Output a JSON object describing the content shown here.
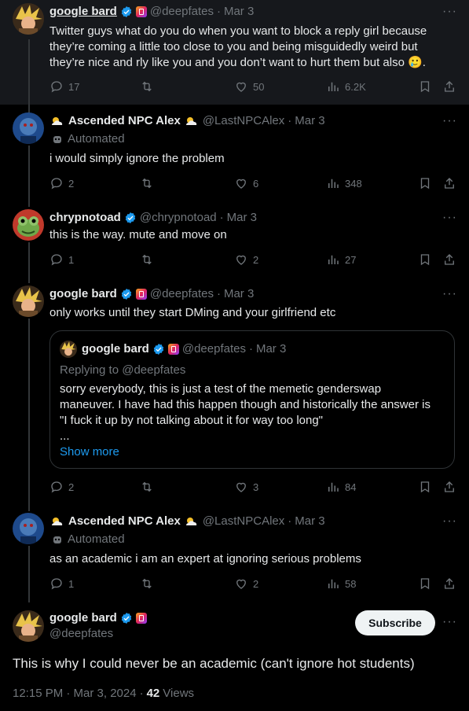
{
  "tweets": [
    {
      "name": "google bard",
      "handle": "@deepfates",
      "date": "Mar 3",
      "text": "Twitter guys what do you do when you want to block a reply girl because they’re coming a little too close to you and being misguidedly weird but they’re nice and rly like you and you don’t want to hurt them but also 🥲.",
      "replies": "17",
      "retweets": "",
      "likes": "50",
      "views": "6.2K"
    },
    {
      "name": "Ascended NPC Alex",
      "handle": "@LastNPCAlex",
      "date": "Mar 3",
      "automated": "Automated",
      "text": "i would simply ignore the problem",
      "replies": "2",
      "retweets": "",
      "likes": "6",
      "views": "348"
    },
    {
      "name": "chrypnotoad",
      "handle": "@chrypnotoad",
      "date": "Mar 3",
      "text": "this is the way. mute and move on",
      "replies": "1",
      "retweets": "",
      "likes": "2",
      "views": "27"
    },
    {
      "name": "google bard",
      "handle": "@deepfates",
      "date": "Mar 3",
      "text": "only works until they start DMing and your girlfriend etc",
      "quote": {
        "name": "google bard",
        "handle": "@deepfates",
        "date": "Mar 3",
        "replying_to": "Replying to @deepfates",
        "line1": "sorry everybody, this is just a test of the memetic genderswap",
        "line2": "maneuver. I have had this happen though and historically the answer is",
        "line3": "\"I fuck it up by not talking about it for way too long\"",
        "line4": "...",
        "show_more": "Show more"
      },
      "replies": "2",
      "retweets": "",
      "likes": "3",
      "views": "84"
    },
    {
      "name": "Ascended NPC Alex",
      "handle": "@LastNPCAlex",
      "date": "Mar 3",
      "automated": "Automated",
      "text": "as an academic i am an expert at ignoring serious problems",
      "replies": "1",
      "retweets": "",
      "likes": "2",
      "views": "58"
    }
  ],
  "main": {
    "name": "google bard",
    "handle": "@deepfates",
    "subscribe_label": "Subscribe",
    "text": "This is why I could never be an academic (can't ignore hot students)",
    "time": "12:15 PM · Mar 3, 2024",
    "sep": "·",
    "views_count": "42",
    "views_label": "Views"
  },
  "colors": {
    "background": "#000000",
    "highlight": "#16181c",
    "text": "#e7e9ea",
    "muted": "#71767b",
    "link": "#1d9bf0",
    "verified": "#1d9bf0"
  },
  "icons": [
    "verified-badge-icon",
    "affiliate-badge-icon",
    "reply-icon",
    "retweet-icon",
    "like-icon",
    "views-icon",
    "bookmark-icon",
    "share-icon",
    "more-icon",
    "robot-icon",
    "cloud-emoji-icon"
  ]
}
